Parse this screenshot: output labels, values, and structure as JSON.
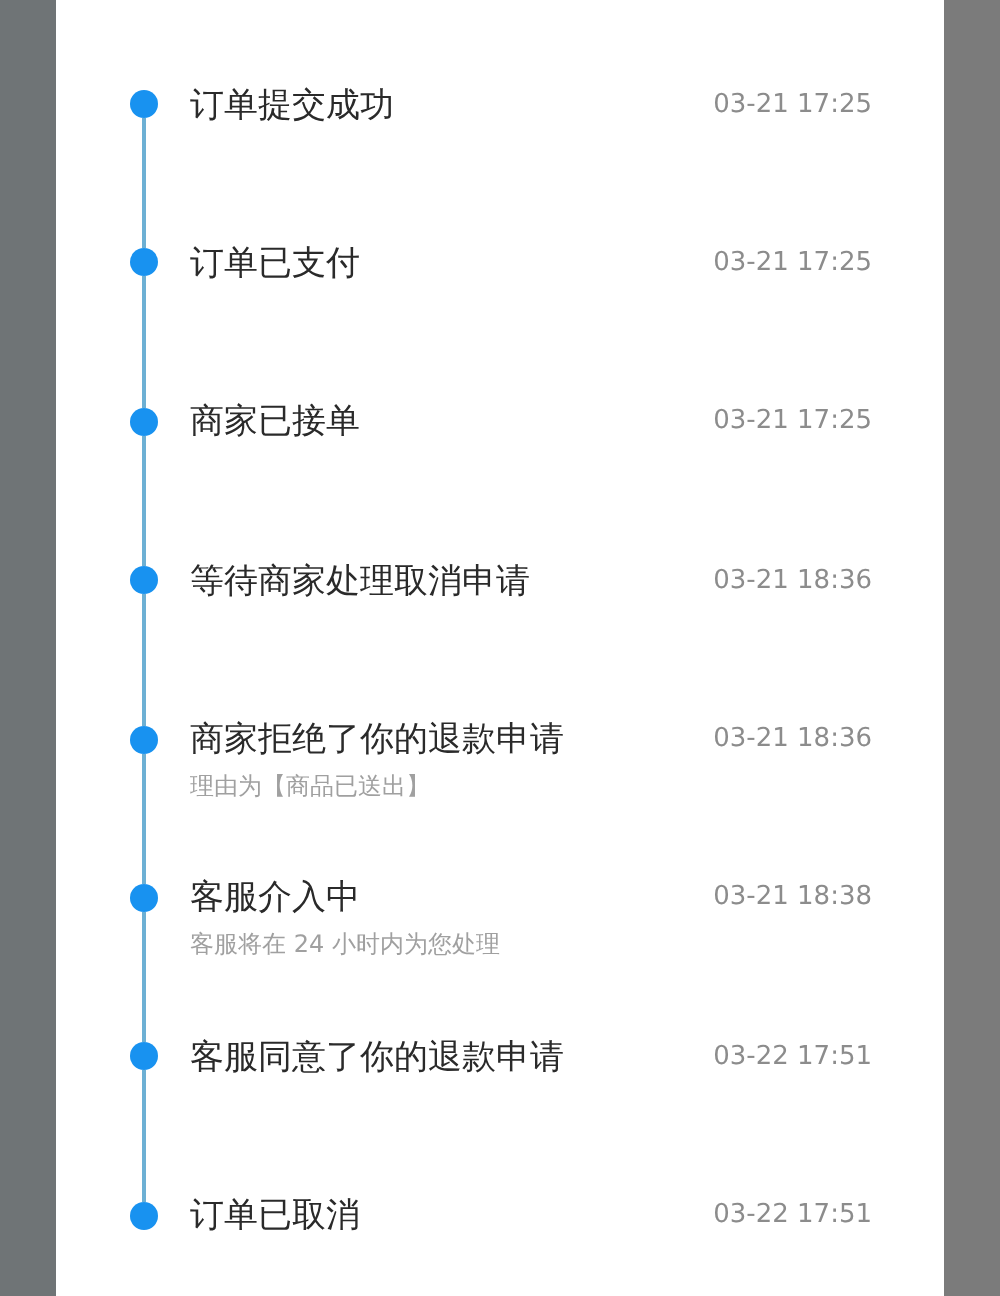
{
  "timeline": [
    {
      "title": "订单提交成功",
      "time": "03-21 17:25"
    },
    {
      "title": "订单已支付",
      "time": "03-21 17:25"
    },
    {
      "title": "商家已接单",
      "time": "03-21 17:25"
    },
    {
      "title": "等待商家处理取消申请",
      "time": "03-21 18:36"
    },
    {
      "title": "商家拒绝了你的退款申请",
      "time": "03-21 18:36",
      "note": "理由为【商品已送出】"
    },
    {
      "title": "客服介入中",
      "time": "03-21 18:38",
      "note": "客服将在 24 小时内为您处理"
    },
    {
      "title": "客服同意了你的退款申请",
      "time": "03-22 17:51"
    },
    {
      "title": "订单已取消",
      "time": "03-22 17:51"
    }
  ]
}
